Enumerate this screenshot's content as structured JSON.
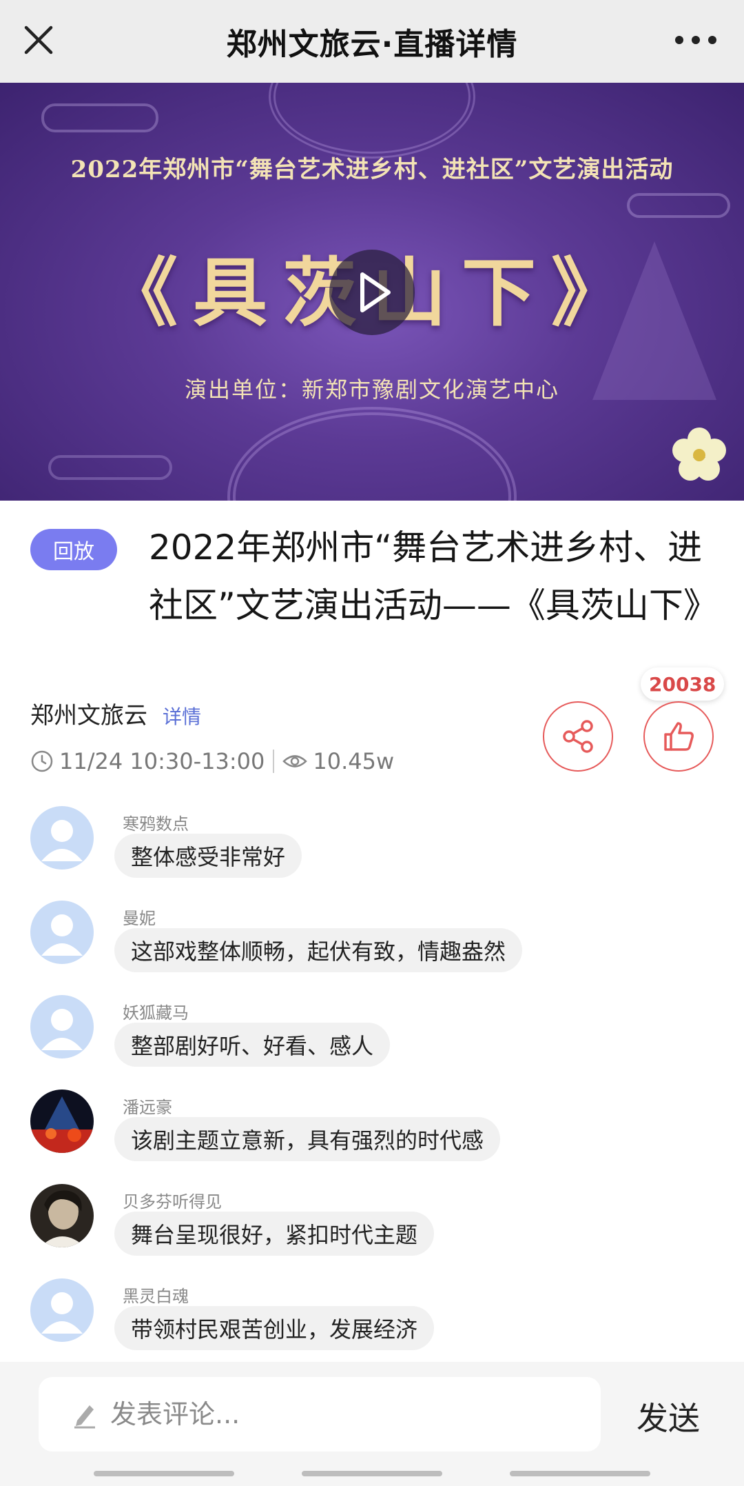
{
  "nav": {
    "title": "郑州文旅云·直播详情"
  },
  "banner": {
    "subtitle": "2022年郑州市“舞台艺术进乡村、进社区”文艺演出活动",
    "big_title": "《具茨山下》",
    "performer": "演出单位：新郑市豫剧文化演艺中心"
  },
  "info": {
    "badge": "回放",
    "title": "2022年郑州市“舞台艺术进乡村、进社区”文艺演出活动——《具茨山下》",
    "org": "郑州文旅云",
    "detail_link": "详情",
    "time": "11/24 10:30-13:00",
    "views": "10.45w",
    "like_count": "20038"
  },
  "comments": [
    {
      "name": "寒鸦数点",
      "text": "整体感受非常好",
      "avatar": "default"
    },
    {
      "name": "曼妮",
      "text": "这部戏整体顺畅，起伏有致，情趣盎然",
      "avatar": "default"
    },
    {
      "name": "妖狐藏马",
      "text": "整部剧好听、好看、感人",
      "avatar": "default"
    },
    {
      "name": "潘远豪",
      "text": "该剧主题立意新，具有强烈的时代感",
      "avatar": "concert-photo"
    },
    {
      "name": "贝多芬听得见",
      "text": "舞台呈现很好，紧扣时代主题",
      "avatar": "portrait-photo"
    },
    {
      "name": "黑灵白魂",
      "text": "带领村民艰苦创业，发展经济",
      "avatar": "default"
    }
  ],
  "footer": {
    "placeholder": "发表评论...",
    "send_label": "发送"
  },
  "colors": {
    "accent_red": "#e65a5a",
    "badge_purple": "#7a7cf0",
    "link_blue": "#5a6fd6",
    "banner_purple": "#5c3a95"
  }
}
